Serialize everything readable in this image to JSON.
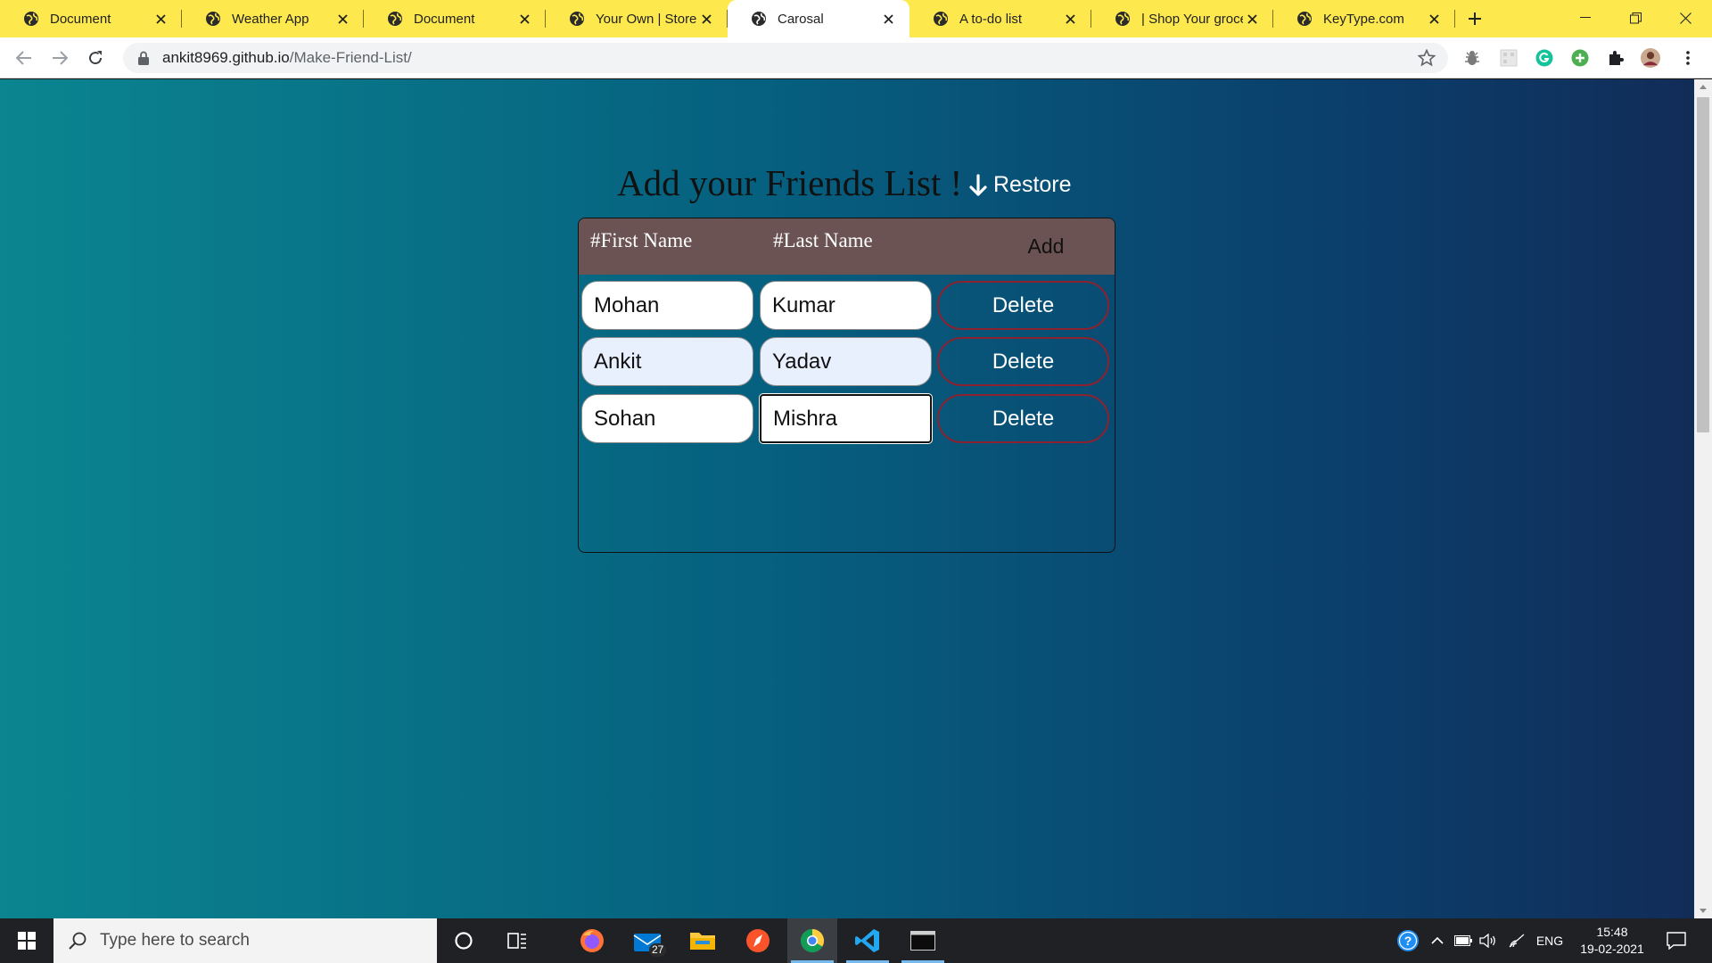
{
  "browser": {
    "tabs": [
      {
        "title": "Document",
        "active": false
      },
      {
        "title": "Weather App",
        "active": false
      },
      {
        "title": "Document",
        "active": false
      },
      {
        "title": "Your Own | Store",
        "active": false
      },
      {
        "title": "Carosal",
        "active": true
      },
      {
        "title": "A to-do list",
        "active": false
      },
      {
        "title": "| Shop Your grocer",
        "active": false
      },
      {
        "title": "KeyType.com",
        "active": false
      }
    ],
    "url_host": "ankit8969.github.io",
    "url_path": "/Make-Friend-List/"
  },
  "page": {
    "heading": "Add your Friends List !",
    "restore_label": "Restore",
    "table": {
      "col_first": "#First Name",
      "col_last": "#Last Name",
      "add_label": "Add",
      "rows": [
        {
          "first": "Mohan",
          "last": "Kumar",
          "delete_label": "Delete"
        },
        {
          "first": "Ankit",
          "last": "Yadav",
          "delete_label": "Delete"
        },
        {
          "first": "Sohan",
          "last": "Mishra",
          "delete_label": "Delete"
        }
      ]
    }
  },
  "taskbar": {
    "search_placeholder": "Type here to search",
    "mail_badge": "27",
    "language": "ENG",
    "time": "15:48",
    "date": "19-02-2021"
  },
  "colors": {
    "tabstrip": "#fde84d",
    "page_gradient_start": "#0b8590",
    "page_gradient_end": "#122c58",
    "card_header": "#6a5352",
    "delete_border": "#8c2230"
  }
}
